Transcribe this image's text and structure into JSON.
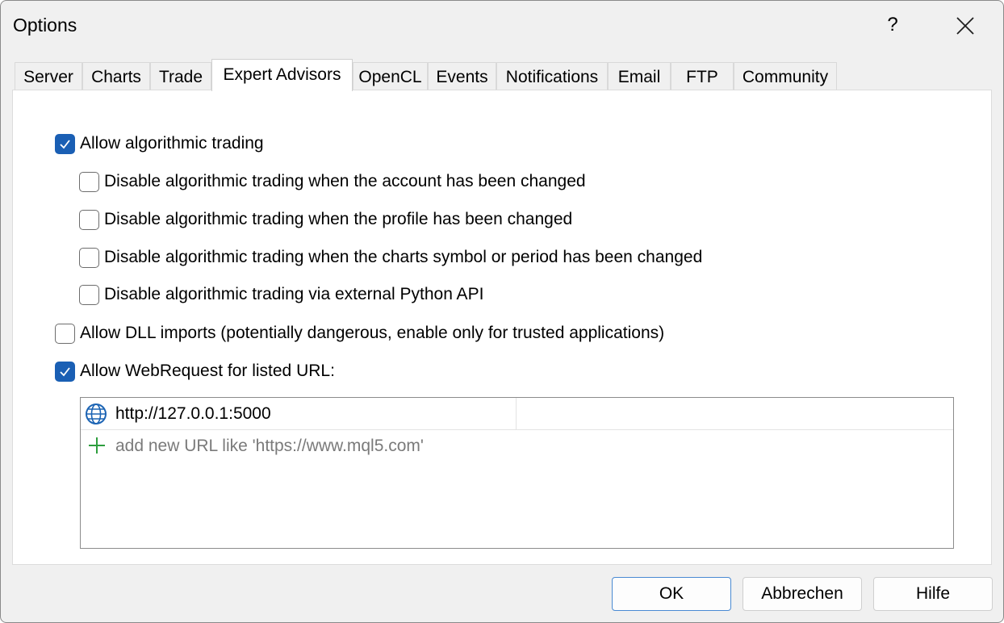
{
  "window": {
    "title": "Options",
    "help_label": "?"
  },
  "tabs": [
    {
      "label": "Server"
    },
    {
      "label": "Charts"
    },
    {
      "label": "Trade"
    },
    {
      "label": "Expert Advisors"
    },
    {
      "label": "OpenCL"
    },
    {
      "label": "Events"
    },
    {
      "label": "Notifications"
    },
    {
      "label": "Email"
    },
    {
      "label": "FTP"
    },
    {
      "label": "Community"
    }
  ],
  "active_tab": "Expert Advisors",
  "options": {
    "allow_algo": {
      "label": "Allow algorithmic trading",
      "checked": true
    },
    "disable_account": {
      "label": "Disable algorithmic trading when the account has been changed",
      "checked": false
    },
    "disable_profile": {
      "label": "Disable algorithmic trading when the profile has been changed",
      "checked": false
    },
    "disable_symbol": {
      "label": "Disable algorithmic trading when the charts symbol or period has been changed",
      "checked": false
    },
    "disable_python": {
      "label": "Disable algorithmic trading via external Python API",
      "checked": false
    },
    "allow_dll": {
      "label": "Allow DLL imports (potentially dangerous, enable only for trusted applications)",
      "checked": false
    },
    "allow_webrequest": {
      "label": "Allow WebRequest for listed URL:",
      "checked": true
    }
  },
  "url_list": {
    "urls": [
      "http://127.0.0.1:5000"
    ],
    "add_placeholder": "add new URL like 'https://www.mql5.com'"
  },
  "buttons": {
    "ok": "OK",
    "cancel": "Abbrechen",
    "help": "Hilfe"
  },
  "colors": {
    "accent": "#1a5fb4",
    "add_green": "#2e9e3e",
    "globe_blue": "#1c64b4"
  }
}
